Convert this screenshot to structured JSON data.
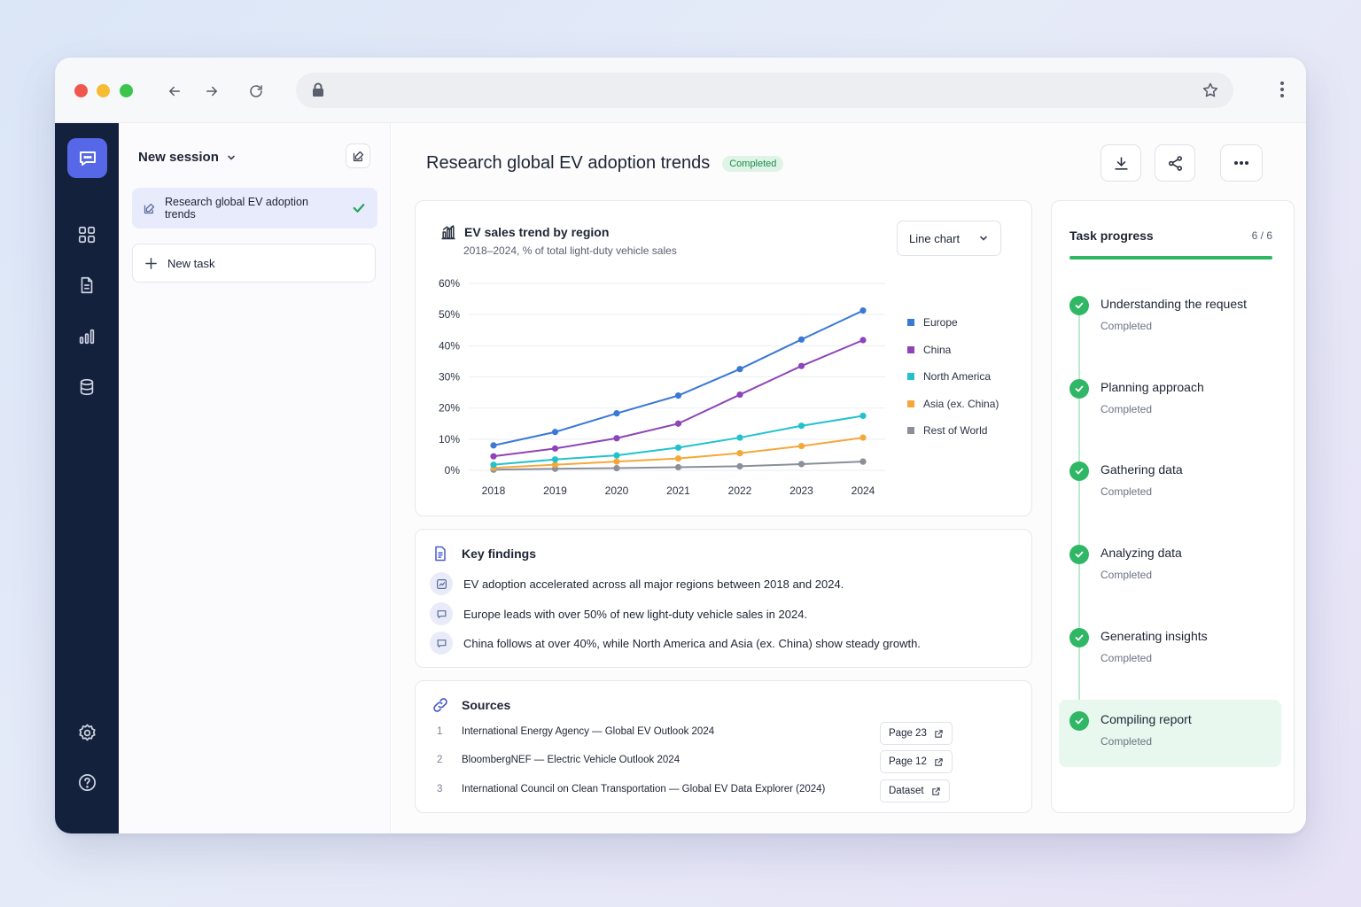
{
  "browser": {
    "url": ""
  },
  "sessions": {
    "header": "New session",
    "items": [
      {
        "label": "Research global EV adoption trends",
        "status": "done"
      }
    ],
    "new_task": "New task"
  },
  "page": {
    "title": "Research global EV adoption trends",
    "badge": "Completed"
  },
  "chart_card": {
    "title": "EV sales trend by region",
    "subtitle": "2018–2024, % of total light-duty vehicle sales",
    "select_value": "Line chart"
  },
  "chart_data": {
    "type": "line",
    "x": [
      "2018",
      "2019",
      "2020",
      "2021",
      "2022",
      "2023",
      "2024"
    ],
    "ylim": [
      0,
      60
    ],
    "yticks": [
      "0%",
      "10%",
      "20%",
      "30%",
      "40%",
      "50%",
      "60%"
    ],
    "grid": true,
    "legend_position": "right",
    "series": [
      {
        "name": "Europe",
        "color": "#3a78d6",
        "values": [
          8,
          12.3,
          18.3,
          24,
          32.5,
          42,
          51.3
        ]
      },
      {
        "name": "China",
        "color": "#8e44b8",
        "values": [
          4.5,
          7,
          10.3,
          15,
          24.3,
          33.5,
          41.8
        ]
      },
      {
        "name": "North America",
        "color": "#22c2cc",
        "values": [
          1.8,
          3.5,
          4.8,
          7.3,
          10.5,
          14.3,
          17.5
        ]
      },
      {
        "name": "Asia (ex. China)",
        "color": "#f5a83a",
        "values": [
          0.8,
          1.8,
          2.8,
          3.8,
          5.5,
          7.8,
          10.5
        ]
      },
      {
        "name": "Rest of World",
        "color": "#8a8f99",
        "values": [
          0.2,
          0.5,
          0.7,
          1,
          1.3,
          2,
          2.8
        ]
      }
    ]
  },
  "findings": {
    "title": "Key findings",
    "items": [
      "EV adoption accelerated across all major regions between 2018 and 2024.",
      "Europe leads with over 50% of new light-duty vehicle sales in 2024.",
      "China follows at over 40%, while North America and Asia (ex. China) show steady growth."
    ]
  },
  "sources": {
    "title": "Sources",
    "items": [
      {
        "num": "1",
        "label": "International Energy Agency — Global EV Outlook 2024",
        "ref": "Page 23"
      },
      {
        "num": "2",
        "label": "BloombergNEF — Electric Vehicle Outlook 2024",
        "ref": "Page 12"
      },
      {
        "num": "3",
        "label": "International Council on Clean Transportation — Global EV Data Explorer (2024)",
        "ref": "Dataset"
      }
    ]
  },
  "progress": {
    "title": "Task progress",
    "count": "6 / 6",
    "fraction": 1.0,
    "steps": [
      {
        "name": "Understanding the request",
        "status": "Completed"
      },
      {
        "name": "Planning approach",
        "status": "Completed"
      },
      {
        "name": "Gathering data",
        "status": "Completed"
      },
      {
        "name": "Analyzing data",
        "status": "Completed"
      },
      {
        "name": "Generating insights",
        "status": "Completed"
      },
      {
        "name": "Compiling report",
        "status": "Completed"
      }
    ]
  }
}
